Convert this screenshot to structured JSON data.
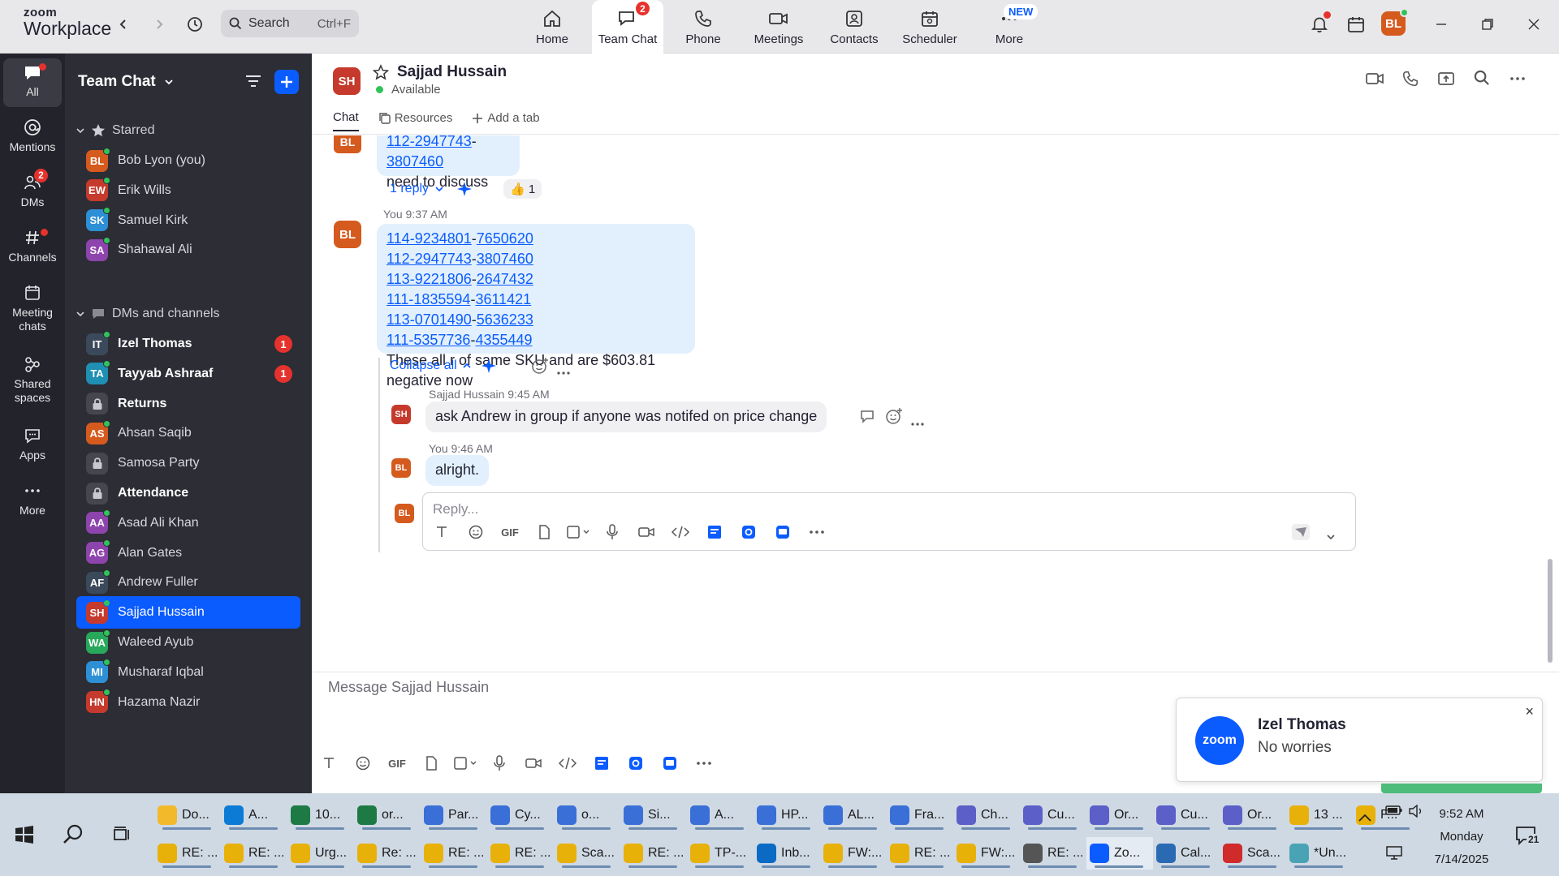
{
  "app": {
    "logo_line1": "zoom",
    "logo_line2": "Workplace",
    "search_placeholder": "Search",
    "search_shortcut": "Ctrl+F",
    "user_initials": "BL",
    "nav_tabs": [
      {
        "label": "Home",
        "icon": "home-icon"
      },
      {
        "label": "Team Chat",
        "icon": "chat-icon",
        "badge": "2",
        "active": true
      },
      {
        "label": "Phone",
        "icon": "phone-icon"
      },
      {
        "label": "Meetings",
        "icon": "video-icon"
      },
      {
        "label": "Contacts",
        "icon": "contacts-icon"
      },
      {
        "label": "Scheduler",
        "icon": "calendar-icon"
      },
      {
        "label": "More",
        "icon": "more-icon",
        "badge_new": "NEW"
      }
    ]
  },
  "rail": [
    {
      "label": "All",
      "icon": "chat-bubble-icon"
    },
    {
      "label": "Mentions",
      "icon": "at-icon"
    },
    {
      "label": "DMs",
      "icon": "people-icon",
      "badge": "2"
    },
    {
      "label": "Channels",
      "icon": "hash-icon"
    },
    {
      "label": "Meeting chats",
      "icon": "calendar-icon"
    },
    {
      "label": "Shared spaces",
      "icon": "shared-icon"
    },
    {
      "label": "Apps",
      "icon": "apps-icon"
    },
    {
      "label": "More",
      "icon": "more-icon"
    }
  ],
  "sidebar": {
    "title": "Team Chat",
    "starred_label": "Starred",
    "dms_label": "DMs and channels",
    "starred": [
      {
        "initials": "BL",
        "name": "Bob Lyon (you)",
        "color": "#d55a1e"
      },
      {
        "initials": "EW",
        "name": "Erik Wills",
        "color": "#c53a2c"
      },
      {
        "initials": "SK",
        "name": "Samuel Kirk",
        "color": "#2d8fd5"
      },
      {
        "initials": "SA",
        "name": "Shahawal Ali",
        "color": "#8e44ad"
      }
    ],
    "dms": [
      {
        "initials": "IT",
        "name": "Izel Thomas",
        "color": "#3b4a5a",
        "bold": true,
        "unread": "1"
      },
      {
        "initials": "TA",
        "name": "Tayyab Ashraaf",
        "color": "#1f8fb3",
        "bold": true,
        "unread": "1"
      },
      {
        "name": "Returns",
        "lock": true,
        "bold": true
      },
      {
        "initials": "AS",
        "name": "Ahsan Saqib",
        "color": "#d55a1e"
      },
      {
        "name": "Samosa Party",
        "lock": true
      },
      {
        "name": "Attendance",
        "lock": true,
        "bold": true
      },
      {
        "initials": "AA",
        "name": "Asad Ali Khan",
        "color": "#8e44ad"
      },
      {
        "initials": "AG",
        "name": "Alan Gates",
        "color": "#8e44ad"
      },
      {
        "initials": "AF",
        "name": "Andrew Fuller",
        "color": "#3b4a5a"
      },
      {
        "initials": "SH",
        "name": "Sajjad Hussain",
        "color": "#c53a2c",
        "selected": true
      },
      {
        "initials": "WA",
        "name": "Waleed Ayub",
        "color": "#27a85a"
      },
      {
        "initials": "MI",
        "name": "Musharaf Iqbal",
        "color": "#2d8fd5"
      },
      {
        "initials": "HN",
        "name": "Hazama Nazir",
        "color": "#c53a2c"
      }
    ]
  },
  "channel": {
    "initials": "SH",
    "name": "Sajjad Hussain",
    "status": "Available",
    "tabs": [
      "Chat",
      "Resources",
      "Add a tab"
    ]
  },
  "messages": {
    "prev_avatar": "BL",
    "prev_link_a": "112-2947743",
    "prev_link_b": "3807460",
    "prev_text": "need to discuss",
    "reply_count": "1 reply",
    "reaction": "👍 1",
    "main_meta": "You 9:37 AM",
    "main_avatar": "BL",
    "sku_lines": [
      {
        "a": "114-9234801",
        "b": "7650620"
      },
      {
        "a": "112-2947743",
        "b": "3807460"
      },
      {
        "a": "113-9221806",
        "b": "2647432"
      },
      {
        "a": "111-1835594",
        "b": "3611421"
      },
      {
        "a": "113-0701490",
        "b": "5636233"
      },
      {
        "a": "111-5357736",
        "b": "4355449"
      }
    ],
    "main_text": "These all r of same SKU and are $603.81 negative now",
    "collapse_all": "Collapse all",
    "thread": [
      {
        "meta": "Sajjad Hussain 9:45 AM",
        "avatar": "SH",
        "color": "#c53a2c",
        "text": "ask Andrew in group if anyone was notifed on price change"
      },
      {
        "meta": "You 9:46 AM",
        "avatar": "BL",
        "color": "#d55a1e",
        "text": "alright."
      }
    ],
    "reply_avatar": "BL",
    "reply_placeholder": "Reply...",
    "gif_label": "GIF"
  },
  "composer": {
    "placeholder": "Message Sajjad Hussain",
    "gif_label": "GIF"
  },
  "toast": {
    "logo": "zoom",
    "name": "Izel Thomas",
    "message": "No worries",
    "close": "×"
  },
  "taskbar": {
    "row1": [
      {
        "label": "Do...",
        "color": "#f2b92b",
        "icon": "file-explorer-icon"
      },
      {
        "label": "A...",
        "color": "#0b7bd6",
        "icon": "edge-icon"
      },
      {
        "label": "10...",
        "color": "#1d7a45",
        "icon": "excel-icon"
      },
      {
        "label": "or...",
        "color": "#1d7a45",
        "icon": "excel-icon"
      },
      {
        "label": "Par...",
        "color": "#3a6fd8",
        "icon": "chrome-icon"
      },
      {
        "label": "Cy...",
        "color": "#3a6fd8",
        "icon": "chrome-icon"
      },
      {
        "label": "o...",
        "color": "#3a6fd8",
        "icon": "chrome-icon"
      },
      {
        "label": "Si...",
        "color": "#3a6fd8",
        "icon": "chrome-icon"
      },
      {
        "label": "A...",
        "color": "#3a6fd8",
        "icon": "chrome-icon"
      },
      {
        "label": "HP...",
        "color": "#3a6fd8",
        "icon": "chrome-icon"
      },
      {
        "label": "AL...",
        "color": "#3a6fd8",
        "icon": "chrome-icon"
      },
      {
        "label": "Fra...",
        "color": "#3a6fd8",
        "icon": "chrome-icon"
      },
      {
        "label": "Ch...",
        "color": "#5b5fc7",
        "icon": "teams-icon"
      },
      {
        "label": "Cu...",
        "color": "#5b5fc7",
        "icon": "teams-icon"
      },
      {
        "label": "Or...",
        "color": "#5b5fc7",
        "icon": "teams-icon"
      },
      {
        "label": "Cu...",
        "color": "#5b5fc7",
        "icon": "teams-icon"
      },
      {
        "label": "Or...",
        "color": "#5b5fc7",
        "icon": "teams-icon"
      },
      {
        "label": "13 ...",
        "color": "#e8b10a",
        "icon": "bell-icon"
      },
      {
        "label": "F...",
        "color": "#e8b10a",
        "icon": "mail-icon"
      }
    ],
    "row2": [
      {
        "label": "RE: ...",
        "color": "#e8b10a",
        "icon": "mail-icon"
      },
      {
        "label": "RE: ...",
        "color": "#e8b10a",
        "icon": "mail-icon"
      },
      {
        "label": "Urg...",
        "color": "#e8b10a",
        "icon": "mail-icon"
      },
      {
        "label": "Re: ...",
        "color": "#e8b10a",
        "icon": "mail-icon"
      },
      {
        "label": "RE: ...",
        "color": "#e8b10a",
        "icon": "mail-icon"
      },
      {
        "label": "RE: ...",
        "color": "#e8b10a",
        "icon": "mail-icon"
      },
      {
        "label": "Sca...",
        "color": "#e8b10a",
        "icon": "mail-icon"
      },
      {
        "label": "RE: ...",
        "color": "#e8b10a",
        "icon": "mail-icon"
      },
      {
        "label": "TP-...",
        "color": "#e8b10a",
        "icon": "mail-icon"
      },
      {
        "label": "Inb...",
        "color": "#0b6ac4",
        "icon": "outlook-icon"
      },
      {
        "label": "FW:...",
        "color": "#e8b10a",
        "icon": "mail-icon"
      },
      {
        "label": "RE: ...",
        "color": "#e8b10a",
        "icon": "mail-icon"
      },
      {
        "label": "FW:...",
        "color": "#e8b10a",
        "icon": "mail-icon"
      },
      {
        "label": "RE: ...",
        "color": "#555555",
        "icon": "mail-icon"
      },
      {
        "label": "Zo...",
        "color": "#0b5cff",
        "icon": "zoom-icon",
        "active": true
      },
      {
        "label": "Cal...",
        "color": "#2a6ab3",
        "icon": "calculator-icon"
      },
      {
        "label": "Sca...",
        "color": "#d02b2b",
        "icon": "pdf-icon"
      },
      {
        "label": "*Un...",
        "color": "#4aa3b5",
        "icon": "notepad-icon"
      }
    ],
    "time": "9:52 AM",
    "day": "Monday",
    "date": "7/14/2025",
    "notif_count": "21"
  }
}
